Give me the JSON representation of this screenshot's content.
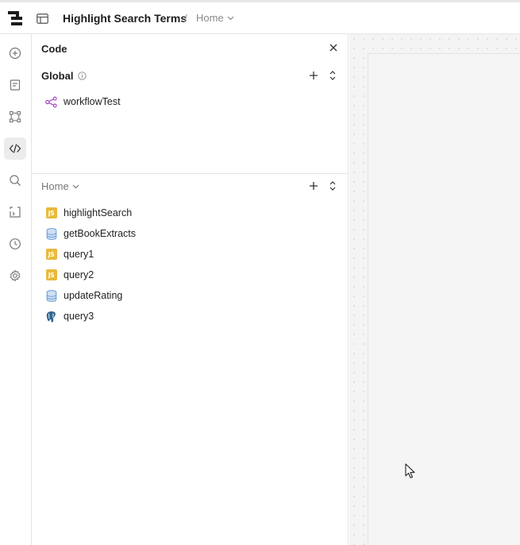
{
  "header": {
    "app_title": "Highlight Search Terms",
    "separator": "/",
    "page": "Home"
  },
  "rail": {
    "items": [
      "add-icon",
      "document-icon",
      "component-icon",
      "code-icon",
      "search-icon",
      "state-icon",
      "history-icon",
      "settings-icon"
    ],
    "active": "code-icon"
  },
  "panel": {
    "title": "Code",
    "global": {
      "label": "Global",
      "items": [
        {
          "name": "workflowTest",
          "icon": "workflow-icon"
        }
      ]
    },
    "page": {
      "label": "Home",
      "items": [
        {
          "name": "highlightSearch",
          "icon": "js-icon",
          "badge": "JS"
        },
        {
          "name": "getBookExtracts",
          "icon": "database-icon"
        },
        {
          "name": "query1",
          "icon": "js-icon",
          "badge": "JS"
        },
        {
          "name": "query2",
          "icon": "js-icon",
          "badge": "JS"
        },
        {
          "name": "updateRating",
          "icon": "database-icon"
        },
        {
          "name": "query3",
          "icon": "postgres-icon"
        }
      ]
    }
  },
  "colors": {
    "js_badge": "#e8b93b",
    "workflow": "#a13fbf",
    "database": "#6a9ed8",
    "postgres": "#336791"
  }
}
